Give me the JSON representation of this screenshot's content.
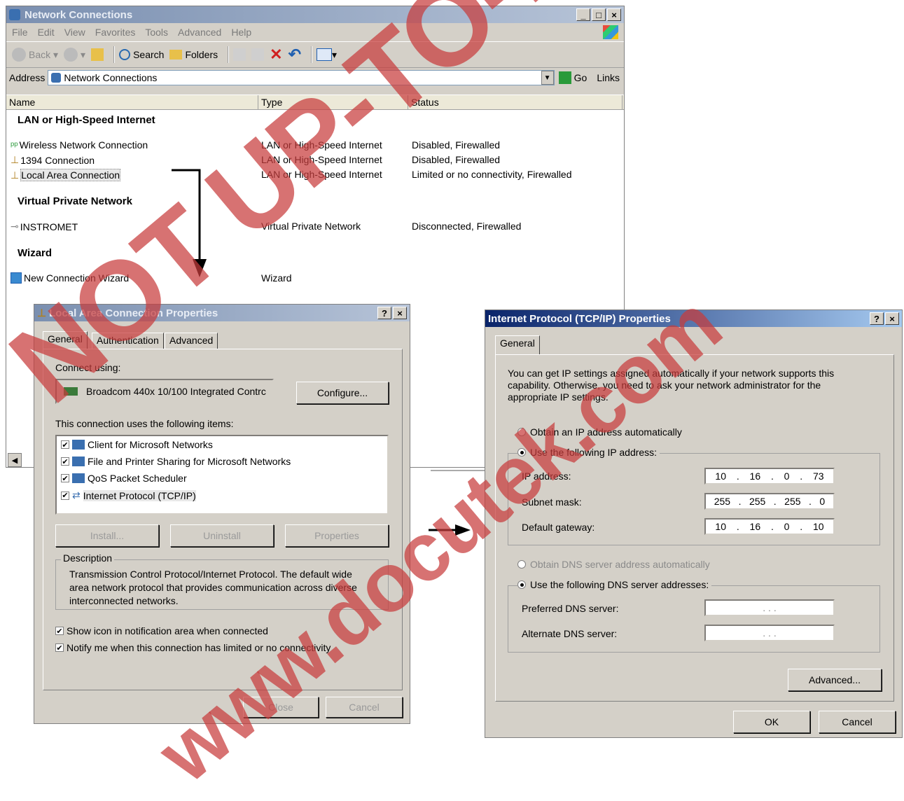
{
  "explorer": {
    "title": "Network Connections",
    "menu": [
      "File",
      "Edit",
      "View",
      "Favorites",
      "Tools",
      "Advanced",
      "Help"
    ],
    "toolbar": {
      "back": "Back",
      "search": "Search",
      "folders": "Folders"
    },
    "address_label": "Address",
    "address_value": "Network Connections",
    "go": "Go",
    "links": "Links",
    "columns": [
      "Name",
      "Type",
      "Status"
    ],
    "groups": [
      {
        "title": "LAN or High-Speed Internet",
        "items": [
          {
            "name": "Wireless Network Connection",
            "type": "LAN or High-Speed Internet",
            "status": "Disabled, Firewalled"
          },
          {
            "name": "1394 Connection",
            "type": "LAN or High-Speed Internet",
            "status": "Disabled, Firewalled"
          },
          {
            "name": "Local Area Connection",
            "type": "LAN or High-Speed Internet",
            "status": "Limited or no connectivity, Firewalled"
          }
        ]
      },
      {
        "title": "Virtual Private Network",
        "items": [
          {
            "name": "INSTROMET",
            "type": "Virtual Private Network",
            "status": "Disconnected, Firewalled"
          }
        ]
      },
      {
        "title": "Wizard",
        "items": [
          {
            "name": "New Connection Wizard",
            "type": "Wizard",
            "status": ""
          }
        ]
      }
    ]
  },
  "lac": {
    "title": "Local Area Connection Properties",
    "tabs": [
      "General",
      "Authentication",
      "Advanced"
    ],
    "connect_using": "Connect using:",
    "adapter": "Broadcom 440x 10/100 Integrated Contrc",
    "configure": "Configure...",
    "items_label": "This connection uses the following items:",
    "items": [
      "Client for Microsoft Networks",
      "File and Printer Sharing for Microsoft Networks",
      "QoS Packet Scheduler",
      "Internet Protocol (TCP/IP)"
    ],
    "install": "Install...",
    "uninstall": "Uninstall",
    "properties": "Properties",
    "description_label": "Description",
    "description": "Transmission Control Protocol/Internet Protocol. The default wide area network protocol that provides communication across diverse interconnected networks.",
    "show_icon": "Show icon in notification area when connected",
    "notify": "Notify me when this connection has limited or no connectivity",
    "close": "Close",
    "cancel": "Cancel"
  },
  "tcp": {
    "title": "Internet Protocol (TCP/IP) Properties",
    "tab": "General",
    "intro": "You can get IP settings assigned automatically if your network supports this capability. Otherwise, you need to ask your network administrator for the appropriate IP settings.",
    "obtain_ip": "Obtain an IP address automatically",
    "use_ip": "Use the following IP address:",
    "ip_label": "IP address:",
    "ip": [
      "10",
      "16",
      "0",
      "73"
    ],
    "mask_label": "Subnet mask:",
    "mask": [
      "255",
      "255",
      "255",
      "0"
    ],
    "gw_label": "Default gateway:",
    "gw": [
      "10",
      "16",
      "0",
      "10"
    ],
    "obtain_dns": "Obtain DNS server address automatically",
    "use_dns": "Use the following DNS server addresses:",
    "pref_dns": "Preferred DNS server:",
    "alt_dns": "Alternate DNS server:",
    "advanced": "Advanced...",
    "ok": "OK",
    "cancel": "Cancel"
  },
  "watermark": {
    "line1": "NOT UP-TO-DATE",
    "line2": "www.docutek.com"
  }
}
